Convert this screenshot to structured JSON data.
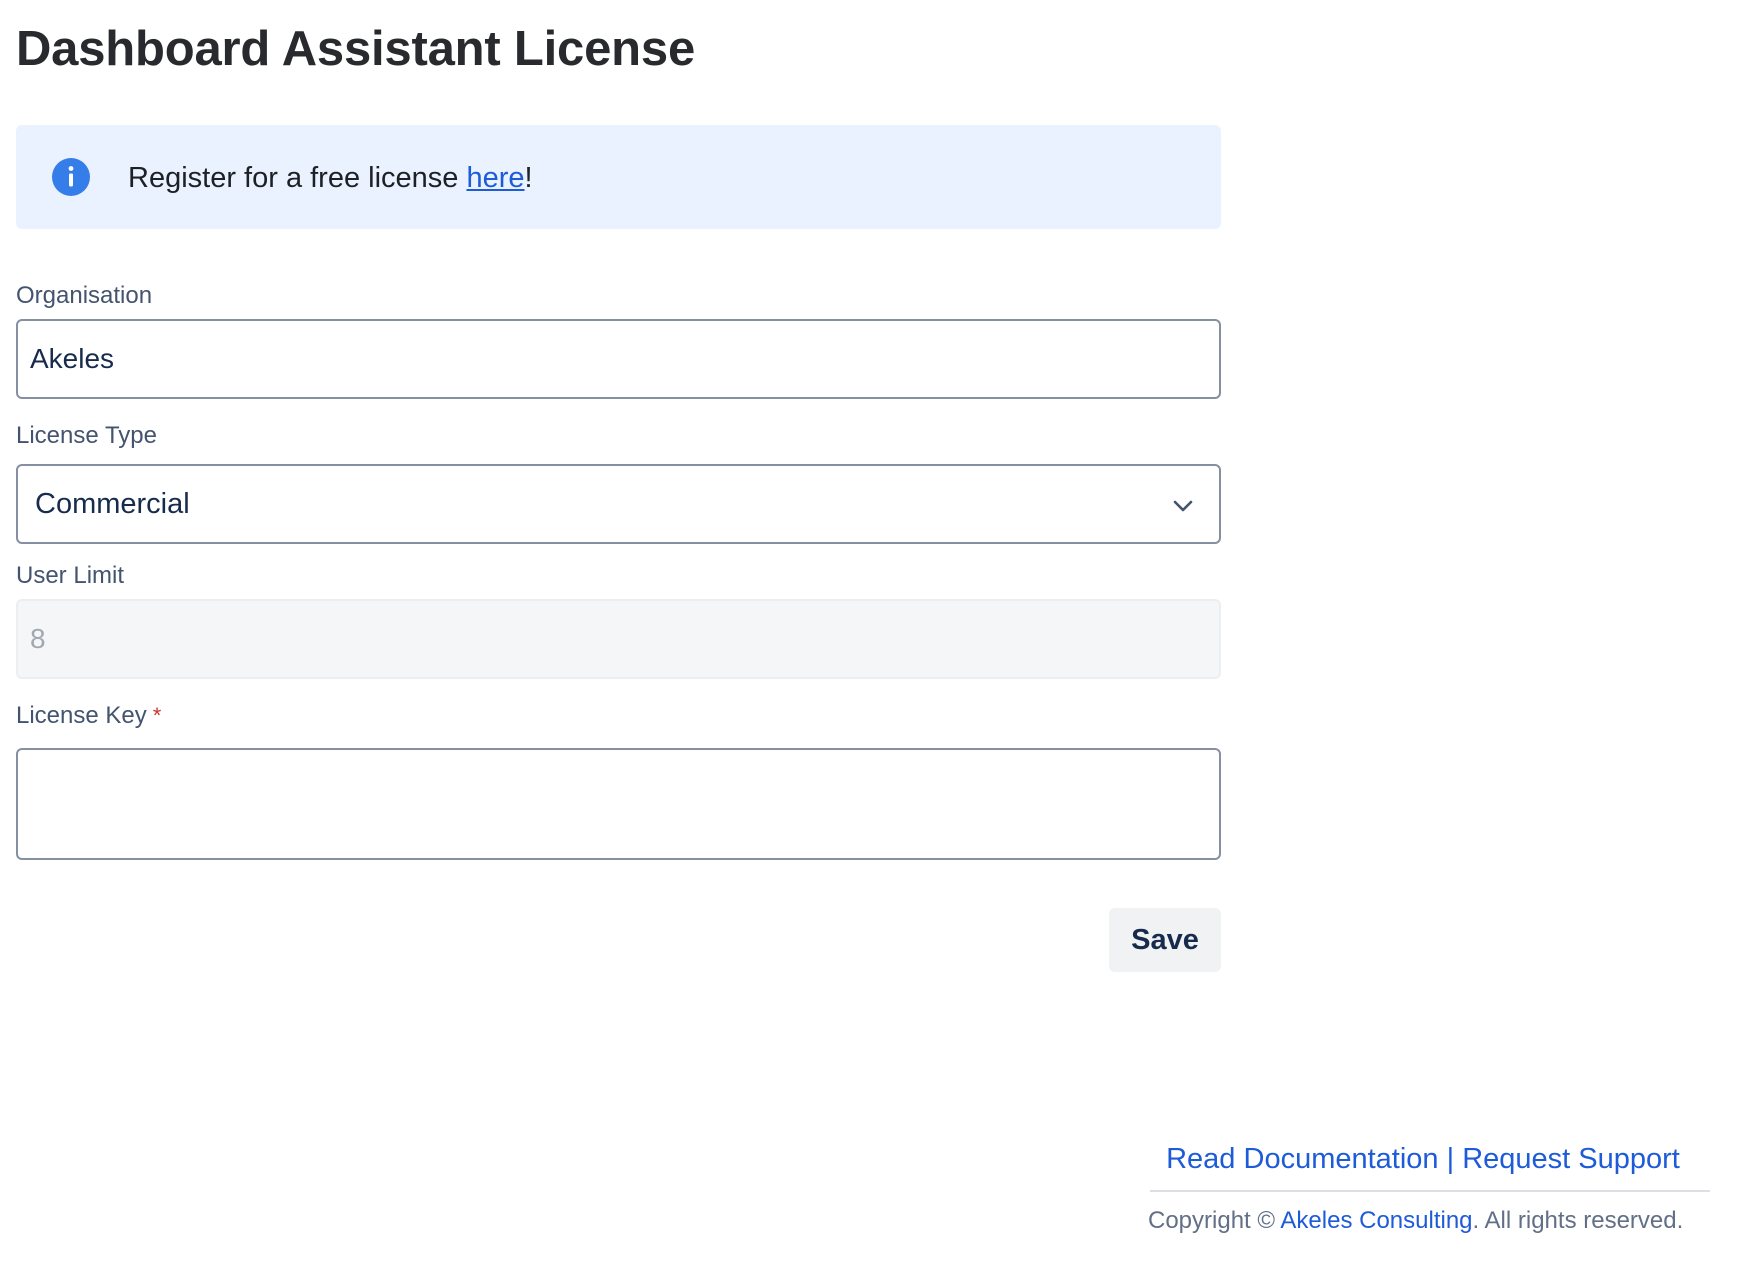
{
  "page": {
    "title": "Dashboard Assistant License"
  },
  "banner": {
    "text_before": "Register for a free license ",
    "link_label": "here",
    "text_after": "!",
    "icon": "info-icon",
    "background": "#e9f2fe",
    "icon_color": "#357de8"
  },
  "form": {
    "organisation": {
      "label": "Organisation",
      "value": "Akeles"
    },
    "license_type": {
      "label": "License Type",
      "selected": "Commercial",
      "icon": "chevron-down-icon"
    },
    "user_limit": {
      "label": "User Limit",
      "value": "8",
      "disabled": true
    },
    "license_key": {
      "label": "License Key",
      "required_marker": "*",
      "value": ""
    },
    "save_label": "Save"
  },
  "footer": {
    "docs_link": "Read Documentation",
    "separator": " | ",
    "support_link": "Request Support",
    "copyright_prefix": "Copyright © ",
    "company_link": "Akeles Consulting",
    "copyright_suffix": ". All rights reserved."
  },
  "colors": {
    "accent": "#1d5bd8",
    "required": "#c9372c",
    "label": "#44546f"
  }
}
